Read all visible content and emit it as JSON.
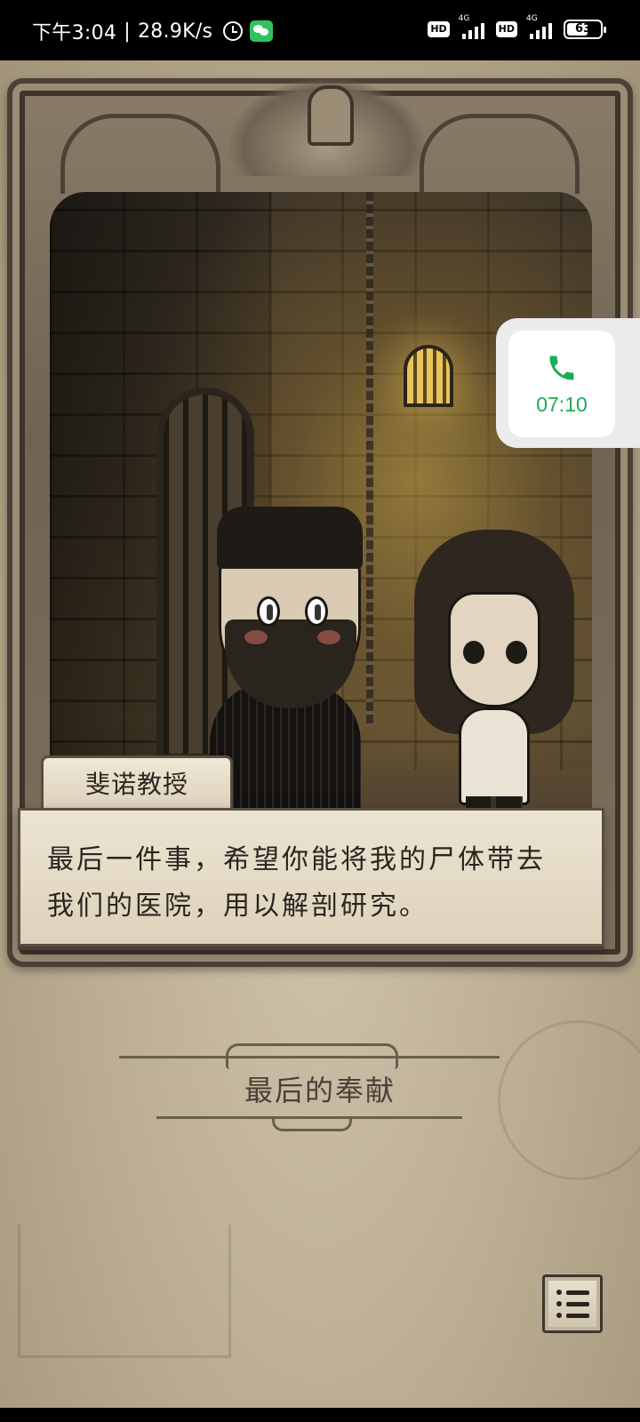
{
  "status_bar": {
    "time": "下午3:04",
    "separator": "|",
    "network_speed": "28.9K/s",
    "hd_label_1": "HD",
    "hd_label_2": "HD",
    "sim1_type": "4G",
    "sim2_type": "4G",
    "battery_level": "63"
  },
  "call_widget": {
    "duration": "07:10",
    "accent_color": "#1aad55"
  },
  "dialog": {
    "speaker": "斐诺教授",
    "line_1": "最后一件事，希望你能将我的尸体带去",
    "line_2": "我们的医院，用以解剖研究。"
  },
  "chapter": {
    "title": "最后的奉献"
  },
  "menu": {
    "icon": "list-menu-icon"
  }
}
